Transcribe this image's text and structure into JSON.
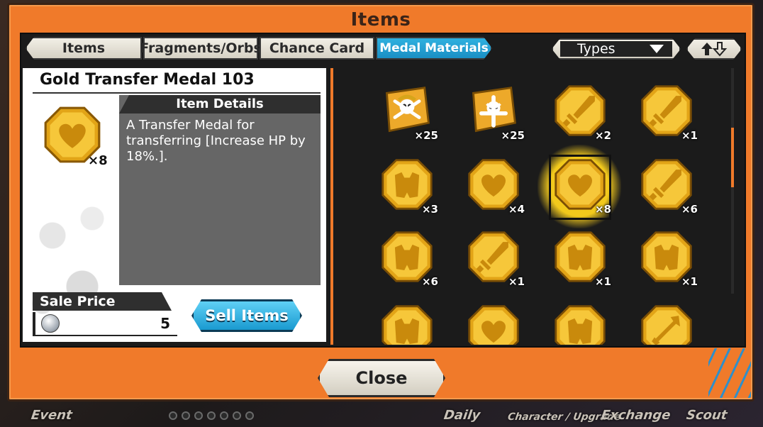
{
  "window": {
    "title": "Items"
  },
  "tabs": [
    {
      "label": "Items"
    },
    {
      "label": "Fragments/Orbs"
    },
    {
      "label": "Chance Card"
    },
    {
      "label": "Medal Materials",
      "active": true
    }
  ],
  "filter": {
    "types_label": "Types",
    "sort_icon": "sort-up-down-icon"
  },
  "detail": {
    "name": "Gold Transfer Medal 103",
    "count": "×8",
    "icon": "heart-medal-icon",
    "details_header": "Item Details",
    "description": "A Transfer Medal for transferring [Increase HP by 18%.].",
    "sale_price_label": "Sale Price",
    "sale_price": "5",
    "sell_button": "Sell Items"
  },
  "grid": [
    {
      "icon": "jolly-roger-icon",
      "count": "×25"
    },
    {
      "icon": "whitebeard-jolly-roger-icon",
      "count": "×25"
    },
    {
      "icon": "sword-medal-icon",
      "count": "×2"
    },
    {
      "icon": "sword-medal-icon",
      "count": "×1"
    },
    {
      "icon": "armor-medal-icon",
      "count": "×3"
    },
    {
      "icon": "heart-medal-icon",
      "count": "×4"
    },
    {
      "icon": "heart-medal-icon",
      "count": "×8",
      "selected": true
    },
    {
      "icon": "sword-medal-icon",
      "count": "×6"
    },
    {
      "icon": "armor-medal-icon",
      "count": "×6"
    },
    {
      "icon": "sword-medal-icon",
      "count": "×1"
    },
    {
      "icon": "armor-medal-icon",
      "count": "×1"
    },
    {
      "icon": "armor-medal-icon",
      "count": "×1"
    },
    {
      "icon": "armor-medal-icon",
      "count": ""
    },
    {
      "icon": "heart-medal-icon",
      "count": ""
    },
    {
      "icon": "armor-medal-icon",
      "count": ""
    },
    {
      "icon": "arrow-medal-icon",
      "count": ""
    }
  ],
  "close_button": "Close",
  "background_nav": [
    "Event",
    "Daily",
    "Character / Upgrade",
    "Exchange",
    "Scout"
  ],
  "colors": {
    "frame": "#f07a2a",
    "active_tab": "#2fb1e0",
    "medal_gold": "#f2b824"
  }
}
